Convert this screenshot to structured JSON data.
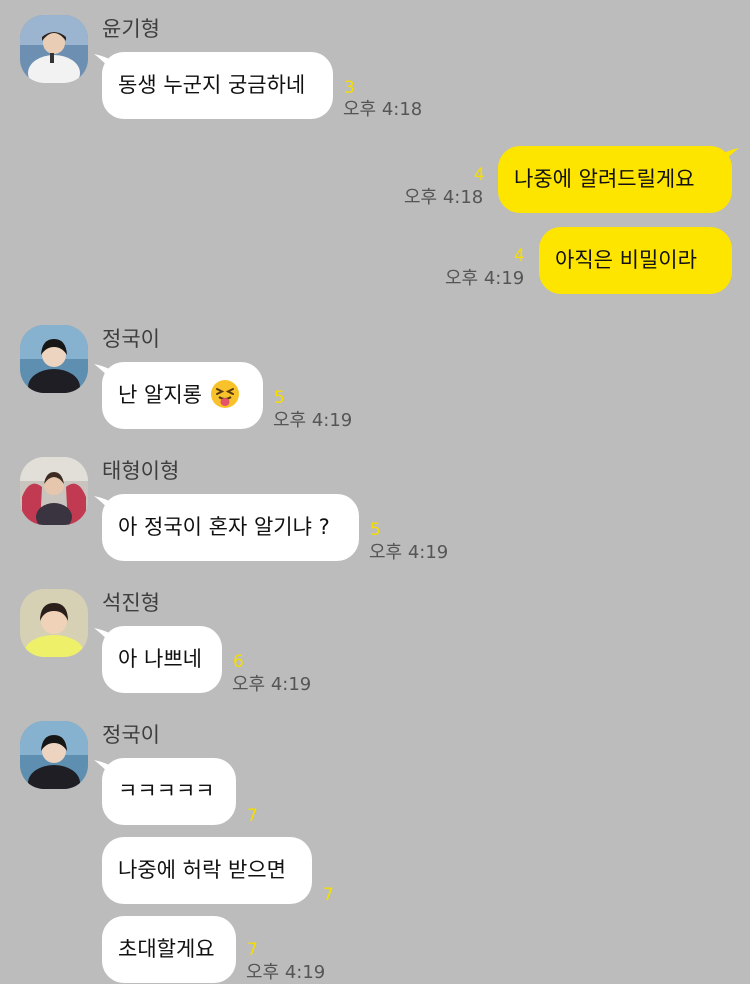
{
  "colors": {
    "background": "#bcbcbc",
    "my_bubble": "#fee500",
    "their_bubble": "#ffffff",
    "unread_count": "#f5dd00"
  },
  "messages": [
    {
      "sender": "윤기형",
      "text": "동생 누군지 궁금하네",
      "unread": "3",
      "time": "오후 4:18"
    },
    {
      "sender": "me",
      "text": "나중에 알려드릴게요",
      "unread": "4",
      "time": "오후 4:18"
    },
    {
      "sender": "me",
      "text": "아직은 비밀이라",
      "unread": "4",
      "time": "오후 4:19"
    },
    {
      "sender": "정국이",
      "text": "난 알지롱",
      "emoji": "squinting-tongue-emoji",
      "unread": "5",
      "time": "오후 4:19"
    },
    {
      "sender": "태형이형",
      "text": "아 정국이 혼자 알기냐 ?",
      "unread": "5",
      "time": "오후 4:19"
    },
    {
      "sender": "석진형",
      "text": "아 나쁘네",
      "unread": "6",
      "time": "오후 4:19"
    },
    {
      "sender": "정국이",
      "text": "ㅋㅋㅋㅋㅋ",
      "unread": "7"
    },
    {
      "sender": "정국이",
      "text": "나중에 허락 받으면",
      "unread": "7"
    },
    {
      "sender": "정국이",
      "text": "초대할게요",
      "unread": "7",
      "time": "오후 4:19"
    }
  ]
}
